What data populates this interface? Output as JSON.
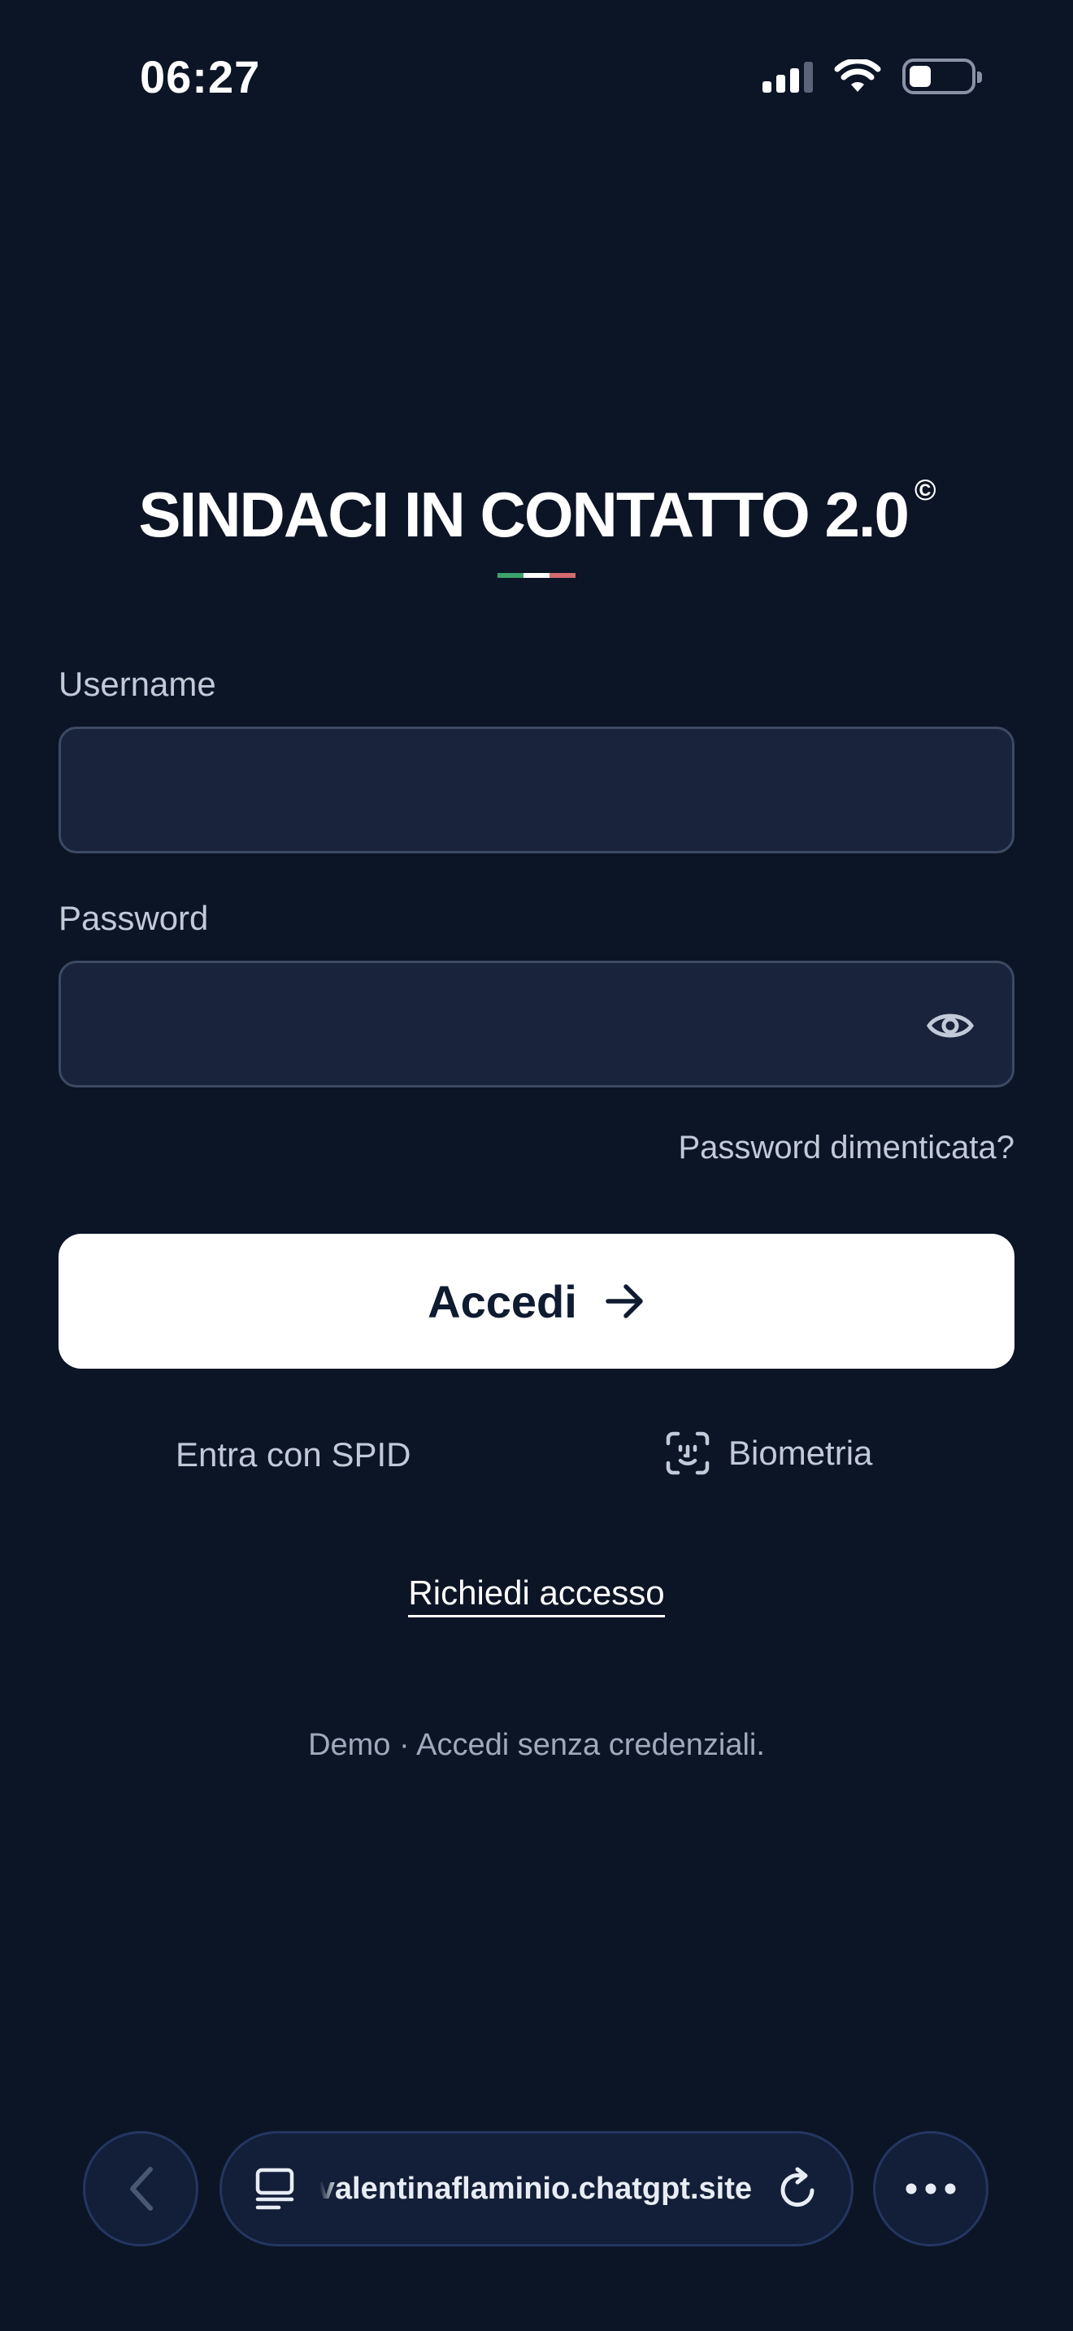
{
  "status_bar": {
    "time": "06:27"
  },
  "app": {
    "title": "SINDACI IN CONTATTO 2.0",
    "title_mark": "©",
    "flag_colors": [
      "#3aa36b",
      "#ffffff",
      "#d26a6e"
    ]
  },
  "login_form": {
    "username_label": "Username",
    "username_value": "",
    "password_label": "Password",
    "password_value": "",
    "forgot_password": "Password dimenticata?",
    "submit_label": "Accedi"
  },
  "alt_login": {
    "spid_label": "Entra con SPID",
    "biometric_label": "Biometria"
  },
  "request_access": "Richiedi accesso",
  "demo_note": "Demo · Accedi senza credenziali.",
  "browser": {
    "url": "valentinaflaminio.chatgpt.site",
    "icons": [
      "back-icon",
      "tabs-icon",
      "reload-icon",
      "more-icon"
    ]
  },
  "colors": {
    "background": "#0c1526",
    "field_bg": "#19233b",
    "button_bg": "#ffffff",
    "button_text": "#0f1b30"
  }
}
